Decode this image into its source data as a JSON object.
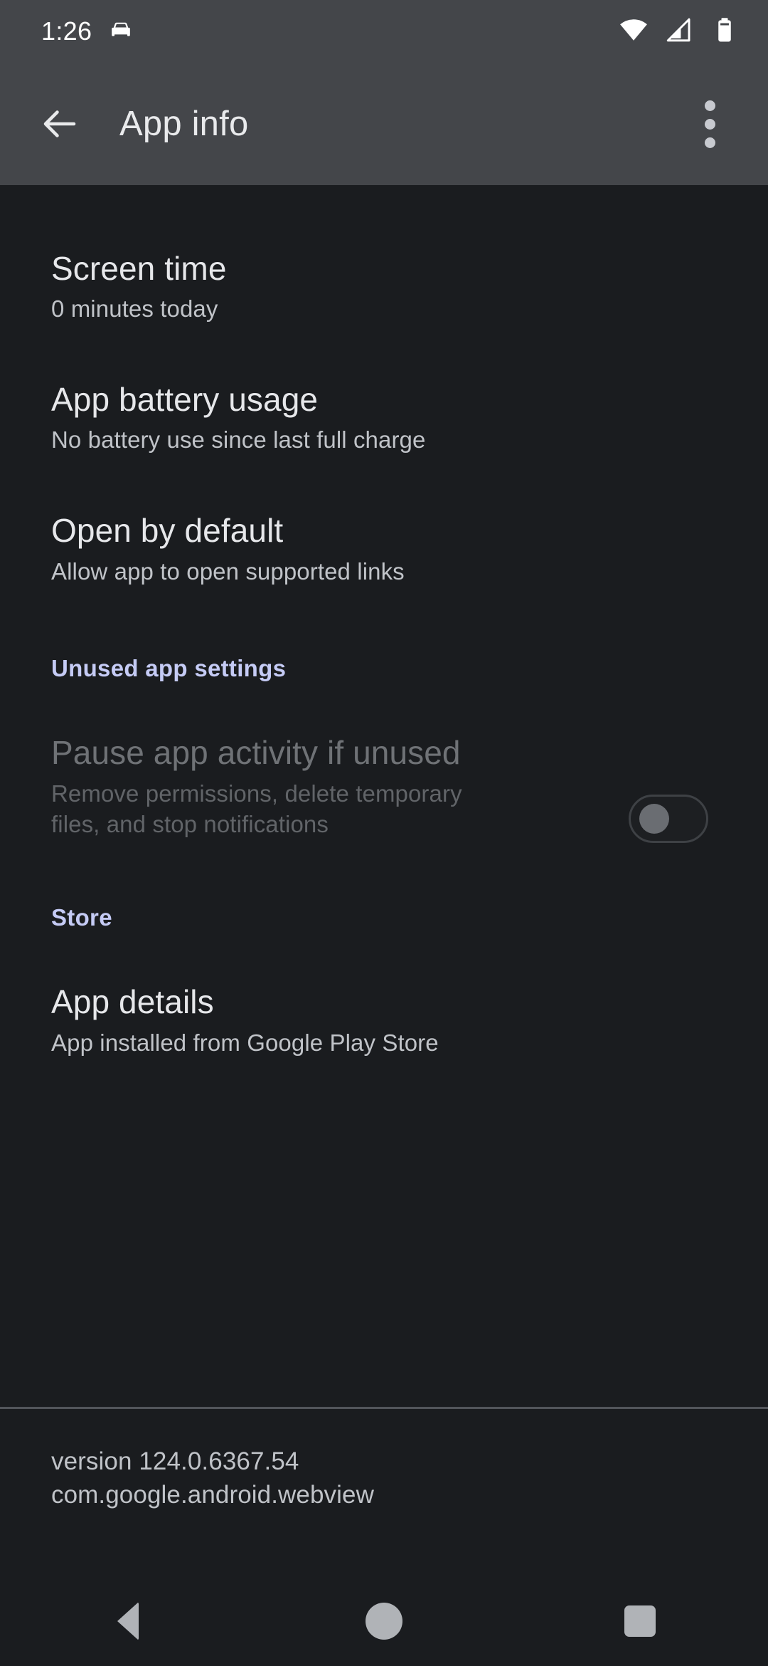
{
  "status_bar": {
    "time": "1:26",
    "icons": [
      "car-icon",
      "wifi-icon",
      "cellular-signal-icon",
      "battery-icon"
    ]
  },
  "app_bar": {
    "back_label": "Back",
    "title": "App info",
    "overflow_label": "More options"
  },
  "preferences": [
    {
      "title": "Screen time",
      "subtitle": "0 minutes today"
    },
    {
      "title": "App battery usage",
      "subtitle": "No battery use since last full charge"
    },
    {
      "title": "Open by default",
      "subtitle": "Allow app to open supported links"
    }
  ],
  "unused_section": {
    "header": "Unused app settings",
    "pause": {
      "title": "Pause app activity if unused",
      "subtitle": "Remove permissions, delete temporary files, and stop notifications",
      "toggle_state": "off"
    }
  },
  "store_section": {
    "header": "Store",
    "details": {
      "title": "App details",
      "subtitle": "App installed from Google Play Store"
    }
  },
  "footer": {
    "version": "version 124.0.6367.54",
    "package": "com.google.android.webview"
  },
  "nav_bar": {
    "back": "Back",
    "home": "Home",
    "recents": "Recent apps"
  },
  "colors": {
    "bar_background": "#44464a",
    "content_background": "#1a1c1f",
    "accent": "#c5cbf5",
    "primary_text": "#e6e7ea",
    "secondary_text": "#c0c3c8",
    "disabled_text": "#6f7276"
  }
}
